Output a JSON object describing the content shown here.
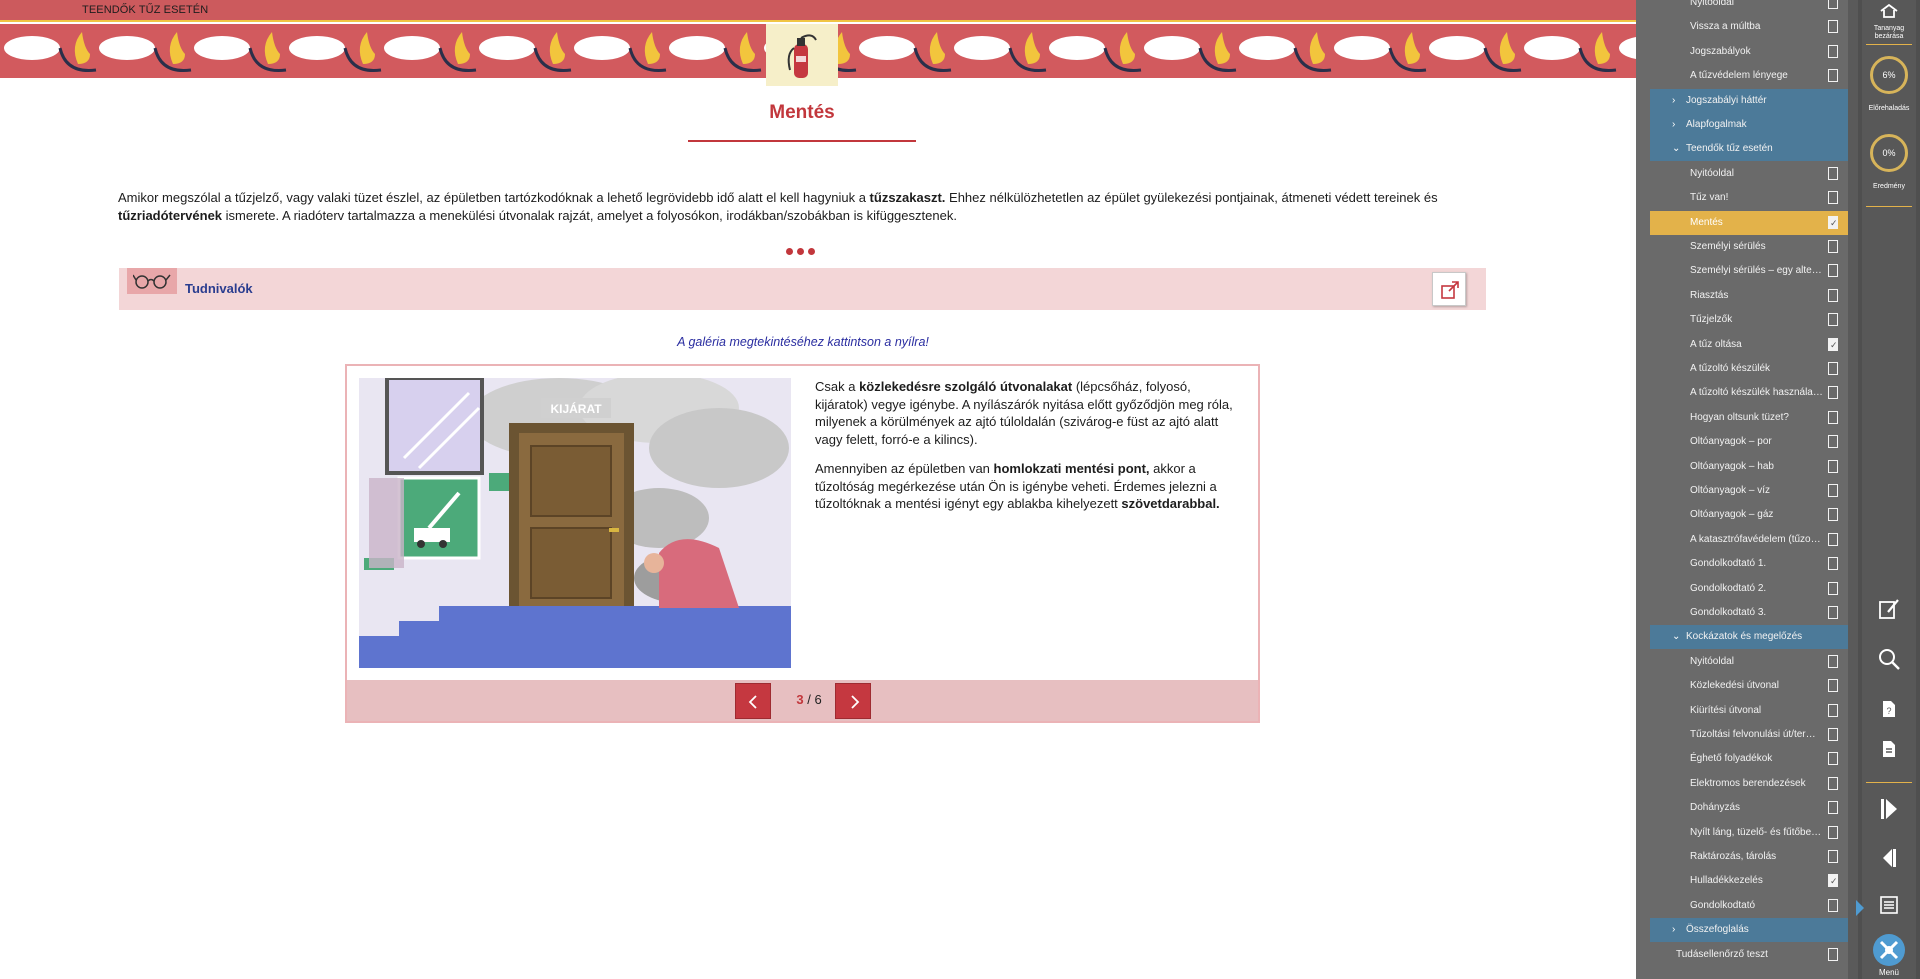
{
  "header": {
    "breadcrumb": "TEENDŐK TŰZ ESETÉN",
    "banner_icon": "fire-extinguisher-icon"
  },
  "page": {
    "title": "Mentés",
    "intro_parts": [
      "Amikor megszólal a tűzjelző, vagy valaki tüzet észlel, az épületben tartózkodóknak a lehető legrövidebb idő alatt el kell hagyniuk a ",
      "tűzszakaszt.",
      " Ehhez nélkülözhetetlen az épület gyülekezési pontjainak, átmeneti védett tereinek és ",
      "tűzriadótervének",
      " ismerete. A riadóterv tartalmazza a menekülési útvonalak rajzát, amelyet a folyosókon, irodákban/szobákban is kifüggesztenek."
    ]
  },
  "notice": {
    "label": "Tudnivalók",
    "icon": "glasses-icon",
    "popout_icon": "external-link-icon"
  },
  "gallery": {
    "hint": "A galéria megtekintéséhez kattintson a nyílra!",
    "image_sign": "KIJÁRAT",
    "p1": [
      "Csak a ",
      "közlekedésre szolgáló útvonalakat",
      " (lépcsőház, folyosó, kijáratok) vegye igénybe. A nyílászárók nyitása előtt győződjön meg róla, milyenek a körülmények az ajtó túloldalán (szivárog-e füst az ajtó alatt vagy felett, forró-e a kilincs)."
    ],
    "p2": [
      "Amennyiben az épületben van ",
      "homlokzati mentési pont,",
      " akkor a tűzoltóság megérkezése után Ön is igénybe veheti. Érdemes jelezni a tűzoltóknak a mentési igényt egy ablakba kihelyezett ",
      "szövetdarabbal."
    ],
    "current": "3",
    "separator": "/",
    "total": "6"
  },
  "outline": {
    "items": [
      {
        "label": "Nyitóoldal",
        "kind": "page",
        "done": false
      },
      {
        "label": "Vissza a múltba",
        "kind": "page",
        "done": false
      },
      {
        "label": "Jogszabályok",
        "kind": "page",
        "done": false
      },
      {
        "label": "A tűzvédelem lényege",
        "kind": "page",
        "done": false
      },
      {
        "label": "Jogszabályi háttér",
        "kind": "section",
        "chev": "›"
      },
      {
        "label": "Alapfogalmak",
        "kind": "section",
        "chev": "›"
      },
      {
        "label": "Teendők tűz esetén",
        "kind": "section",
        "chev": "⌄"
      },
      {
        "label": "Nyitóoldal",
        "kind": "page",
        "done": false
      },
      {
        "label": "Tűz van!",
        "kind": "page",
        "done": false
      },
      {
        "label": "Mentés",
        "kind": "page",
        "done": true,
        "active": true
      },
      {
        "label": "Személyi sérülés",
        "kind": "page",
        "done": false
      },
      {
        "label": "Személyi sérülés – egy alter…",
        "kind": "page",
        "done": false
      },
      {
        "label": "Riasztás",
        "kind": "page",
        "done": false
      },
      {
        "label": "Tűzjelzők",
        "kind": "page",
        "done": false
      },
      {
        "label": "A tűz oltása",
        "kind": "page",
        "done": true
      },
      {
        "label": "A tűzoltó készülék",
        "kind": "page",
        "done": false
      },
      {
        "label": "A tűzoltó készülék használa…",
        "kind": "page",
        "done": false
      },
      {
        "label": "Hogyan oltsunk tüzet?",
        "kind": "page",
        "done": false
      },
      {
        "label": "Oltóanyagok – por",
        "kind": "page",
        "done": false
      },
      {
        "label": "Oltóanyagok – hab",
        "kind": "page",
        "done": false
      },
      {
        "label": "Oltóanyagok – víz",
        "kind": "page",
        "done": false
      },
      {
        "label": "Oltóanyagok – gáz",
        "kind": "page",
        "done": false
      },
      {
        "label": "A katasztrófavédelem (tűzo…",
        "kind": "page",
        "done": false
      },
      {
        "label": "Gondolkodtató 1.",
        "kind": "page",
        "done": false
      },
      {
        "label": "Gondolkodtató 2.",
        "kind": "page",
        "done": false
      },
      {
        "label": "Gondolkodtató 3.",
        "kind": "page",
        "done": false
      },
      {
        "label": "Kockázatok és megelőzés",
        "kind": "section",
        "chev": "⌄"
      },
      {
        "label": "Nyitóoldal",
        "kind": "page",
        "done": false
      },
      {
        "label": "Közlekedési útvonal",
        "kind": "page",
        "done": false
      },
      {
        "label": "Kiürítési útvonal",
        "kind": "page",
        "done": false
      },
      {
        "label": "Tűzoltási felvonulási út/ter…",
        "kind": "page",
        "done": false
      },
      {
        "label": "Éghető folyadékok",
        "kind": "page",
        "done": false
      },
      {
        "label": "Elektromos berendezések",
        "kind": "page",
        "done": false
      },
      {
        "label": "Dohányzás",
        "kind": "page",
        "done": false
      },
      {
        "label": "Nyílt láng, tüzelő- és fűtőbe…",
        "kind": "page",
        "done": false
      },
      {
        "label": "Raktározás, tárolás",
        "kind": "page",
        "done": false
      },
      {
        "label": "Hulladékkezelés",
        "kind": "page",
        "done": true
      },
      {
        "label": "Gondolkodtató",
        "kind": "page",
        "done": false
      },
      {
        "label": "Összefoglalás",
        "kind": "section",
        "chev": "›"
      },
      {
        "label": "Tudásellenőrző teszt",
        "kind": "plain",
        "done": false
      }
    ]
  },
  "toolbar": {
    "close_label_1": "Tananyag",
    "close_label_2": "bezárása",
    "progress_value": "6%",
    "progress_label": "Előrehaladás",
    "result_value": "0%",
    "result_label": "Eredmény",
    "menu_label": "Menü",
    "accent": "#e3b24a"
  }
}
